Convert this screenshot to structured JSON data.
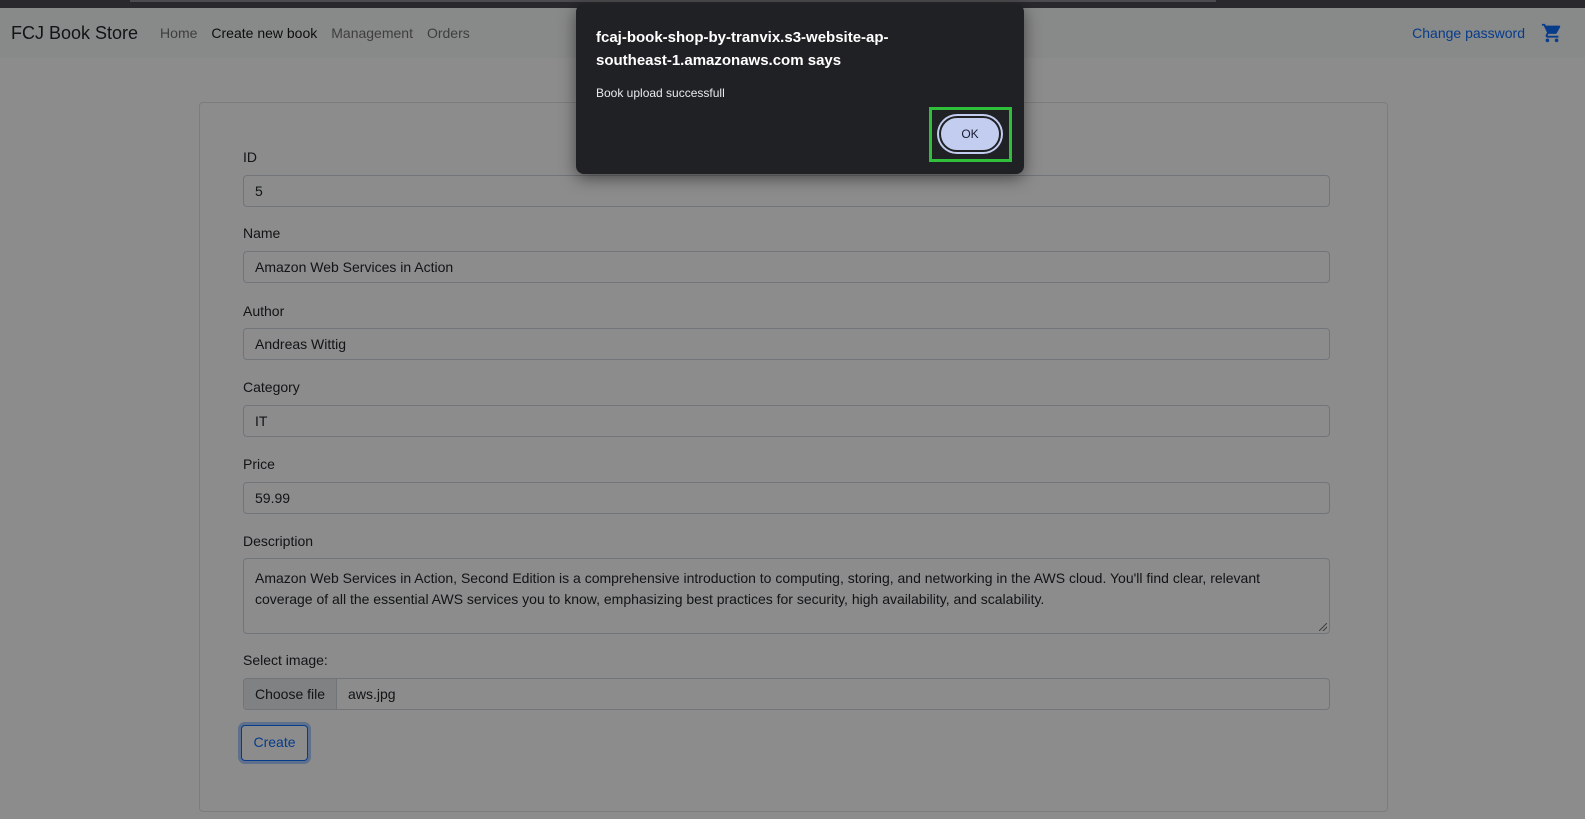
{
  "navbar": {
    "brand": "FCJ Book Store",
    "links": [
      {
        "label": "Home",
        "active": false
      },
      {
        "label": "Create new book",
        "active": true
      },
      {
        "label": "Management",
        "active": false
      },
      {
        "label": "Orders",
        "active": false
      }
    ],
    "change_password": "Change password",
    "cart_icon": "cart-icon"
  },
  "form": {
    "id": {
      "label": "ID",
      "value": "5"
    },
    "name": {
      "label": "Name",
      "value": "Amazon Web Services in Action"
    },
    "author": {
      "label": "Author",
      "value": "Andreas Wittig"
    },
    "category": {
      "label": "Category",
      "value": "IT"
    },
    "price": {
      "label": "Price",
      "value": "59.99"
    },
    "description": {
      "label": "Description",
      "value": "Amazon Web Services in Action, Second Edition is a comprehensive introduction to computing, storing, and networking in the AWS cloud. You'll find clear, relevant coverage of all the essential AWS services you to know, emphasizing best practices for security, high availability, and scalability."
    },
    "image": {
      "label": "Select image:",
      "button": "Choose file",
      "filename": "aws.jpg"
    },
    "submit": "Create"
  },
  "dialog": {
    "title": "fcaj-book-shop-by-tranvix.s3-website-ap-southeast-1.amazonaws.com says",
    "message": "Book upload successfull",
    "ok": "OK"
  },
  "colors": {
    "link": "#0d6efd",
    "dialog_bg": "#202124",
    "ok_button": "#c2cdf0",
    "highlight": "#2fbf3a"
  }
}
